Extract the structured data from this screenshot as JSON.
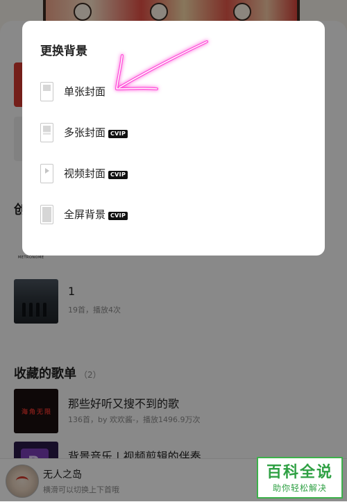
{
  "dialog": {
    "title": "更换背景",
    "options": [
      {
        "label": "单张封面",
        "icon": "single-cover-icon",
        "vip": false
      },
      {
        "label": "多张封面",
        "icon": "multi-cover-icon",
        "vip": true
      },
      {
        "label": "视频封面",
        "icon": "video-cover-icon",
        "vip": true
      },
      {
        "label": "全屏背景",
        "icon": "fullscreen-background-icon",
        "vip": true
      }
    ],
    "vip_badge": "CVIP"
  },
  "background": {
    "created_section_title": "创",
    "metro_thumb_text": "METRONOME",
    "created_playlists": [
      {
        "title": "1",
        "subtitle": "19首，播放4次"
      }
    ],
    "favorites_title": "收藏的歌单",
    "favorites_count": "（2）",
    "favorite_playlists": [
      {
        "title": "那些好听又搜不到的歌",
        "subtitle": "136首，by 欢欢酱-，播放1496.9万次",
        "thumb_text": "海角无限"
      },
      {
        "title": "背景音乐 | 视频剪辑的伴奏",
        "subtitle": "",
        "thumb_text": "P"
      }
    ]
  },
  "player": {
    "song": "无人之岛",
    "hint": "横滑可以切换上下首哦"
  },
  "watermark": {
    "top": "百科全说",
    "bottom": "助你轻松解决"
  },
  "colors": {
    "accent_red": "#d33a31",
    "annotation_arrow": "#ff4fd8",
    "watermark_green": "#2ea043"
  }
}
